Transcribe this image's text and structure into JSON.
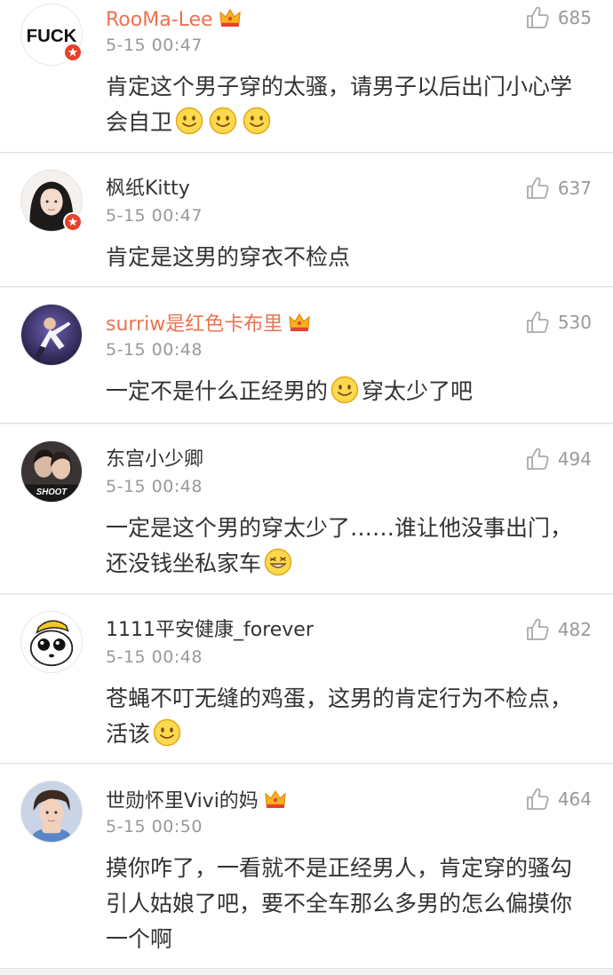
{
  "comments": [
    {
      "username": "RooMa-Lee",
      "vip": true,
      "time": "5-15 00:47",
      "likes": "685",
      "text_parts": [
        "肯定这个男子穿的太骚，请男子以后出门小心学会自卫"
      ],
      "emoji_after_text": [
        "smile-emoji",
        "smile-emoji",
        "smile-emoji"
      ],
      "avatar": "fuck-text-avatar",
      "avatar_text": "FUCK"
    },
    {
      "username": "枫纸Kitty",
      "vip": false,
      "time": "5-15 00:47",
      "likes": "637",
      "text_parts": [
        "肯定是这男的穿衣不检点"
      ],
      "avatar": "girl-photo-avatar"
    },
    {
      "username": "surriw是红色卡布里",
      "vip": true,
      "time": "5-15 00:48",
      "likes": "530",
      "text_parts": [
        "一定不是什么正经男的",
        "穿太少了吧"
      ],
      "avatar": "dancer-photo-avatar"
    },
    {
      "username": "东宫小少卿",
      "vip": false,
      "time": "5-15 00:48",
      "likes": "494",
      "text_parts": [
        "一定是这个男的穿太少了……谁让他没事出门，还没钱坐私家车"
      ],
      "avatar": "shoot-photo-avatar",
      "avatar_text": "SHOOT"
    },
    {
      "username": "1111平安健康_forever",
      "vip": false,
      "time": "5-15 00:48",
      "likes": "482",
      "text_parts": [
        "苍蝇不叮无缝的鸡蛋，这男的肯定行为不检点，活该"
      ],
      "avatar": "cartoon-face-avatar"
    },
    {
      "username": "世勋怀里Vivi的妈",
      "vip": true,
      "time": "5-15 00:50",
      "likes": "464",
      "text_parts": [
        "摸你咋了，一看就不是正经男人，肯定穿的骚勾引人姑娘了吧，要不全车那么多男的怎么偏摸你一个啊"
      ],
      "avatar": "boy-photo-avatar"
    }
  ],
  "colors": {
    "vip_name": "#eb7350",
    "normal_name": "#333333",
    "meta": "#999999",
    "badge": "#e8412c",
    "background": "#f2f2f2"
  },
  "icons": [
    "like-thumb-icon",
    "vip-crown-icon",
    "verified-badge-icon",
    "smile-emoji",
    "grin-emoji"
  ]
}
